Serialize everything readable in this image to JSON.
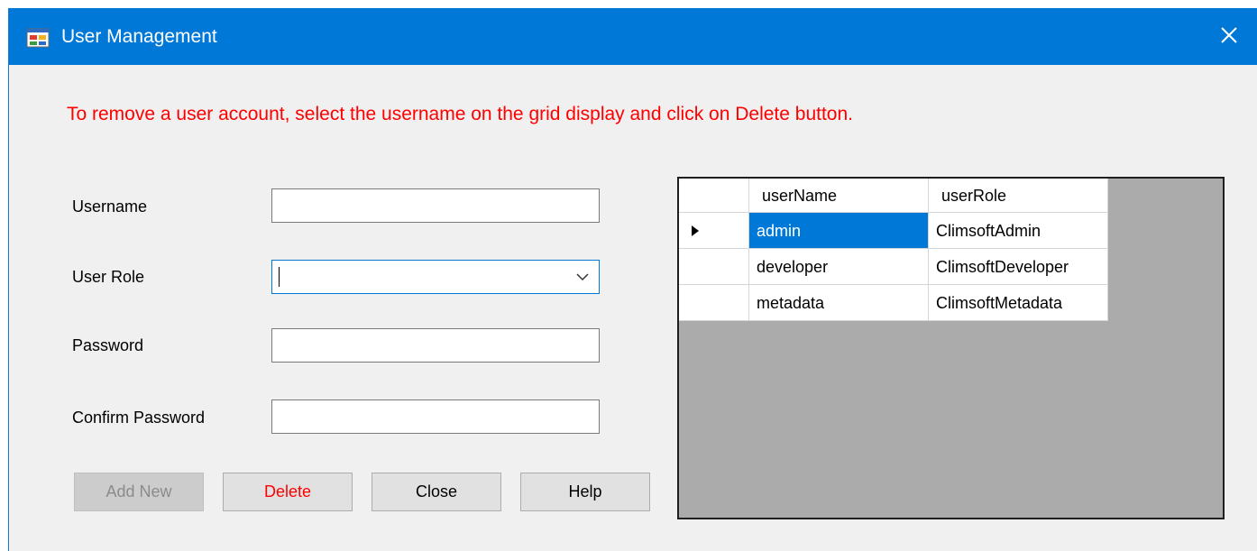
{
  "window": {
    "title": "User Management"
  },
  "instruction": "To remove a user account, select the username on the grid display and click on Delete button.",
  "form": {
    "username_label": "Username",
    "username_value": "",
    "role_label": "User Role",
    "role_value": "",
    "password_label": "Password",
    "password_value": "",
    "confirm_label": "Confirm Password",
    "confirm_value": ""
  },
  "buttons": {
    "add_new": "Add New",
    "delete": "Delete",
    "close": "Close",
    "help": "Help"
  },
  "grid": {
    "columns": [
      "userName",
      "userRole"
    ],
    "rows": [
      {
        "userName": "admin",
        "userRole": "ClimsoftAdmin",
        "selected": true
      },
      {
        "userName": "developer",
        "userRole": "ClimsoftDeveloper",
        "selected": false
      },
      {
        "userName": "metadata",
        "userRole": "ClimsoftMetadata",
        "selected": false
      }
    ]
  },
  "colors": {
    "titlebar": "#0078d7",
    "instruction_text": "#ff0000",
    "selection": "#0078d7",
    "grid_background": "#ababab"
  },
  "icons": {
    "window_icon": "app-form-icon",
    "close": "close-icon",
    "dropdown": "chevron-down-icon",
    "row_indicator": "current-row-arrow-icon"
  }
}
